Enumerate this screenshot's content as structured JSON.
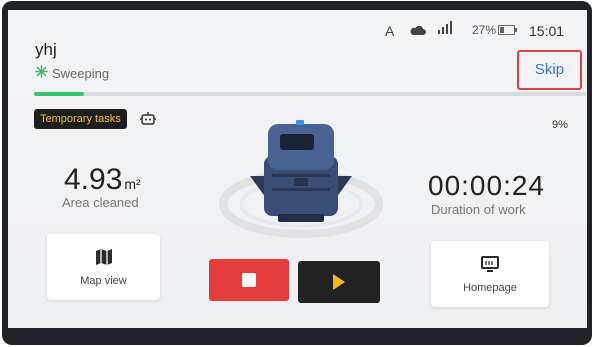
{
  "status_bar": {
    "indicator": "A",
    "cloud_icon": "cloud-icon",
    "signal_icon": "signal-icon",
    "battery_text": "27%",
    "battery_level": 0.27,
    "time": "15:01"
  },
  "header": {
    "device_name": "yhj",
    "state_icon": "sweeping-icon",
    "state_label": "Sweeping",
    "skip_label": "Skip"
  },
  "progress": {
    "percent_text": "9%",
    "fraction": 0.09
  },
  "tasks": {
    "label": "Temporary tasks",
    "icon": "robot-icon"
  },
  "stats": {
    "area_value": "4.93",
    "area_unit": "m²",
    "area_label": "Area cleaned",
    "duration_value": "00:00:24",
    "duration_label": "Duration of work"
  },
  "actions": {
    "map_label": "Map view",
    "map_icon": "map-icon",
    "home_label": "Homepage",
    "home_icon": "monitor-icon",
    "stop_icon": "stop-icon",
    "play_icon": "play-icon"
  },
  "colors": {
    "progress": "#37c46a",
    "stop": "#e53c3c",
    "play_icon": "#f2b817",
    "skip_text": "#3a72d9",
    "highlight": "#e04040"
  }
}
